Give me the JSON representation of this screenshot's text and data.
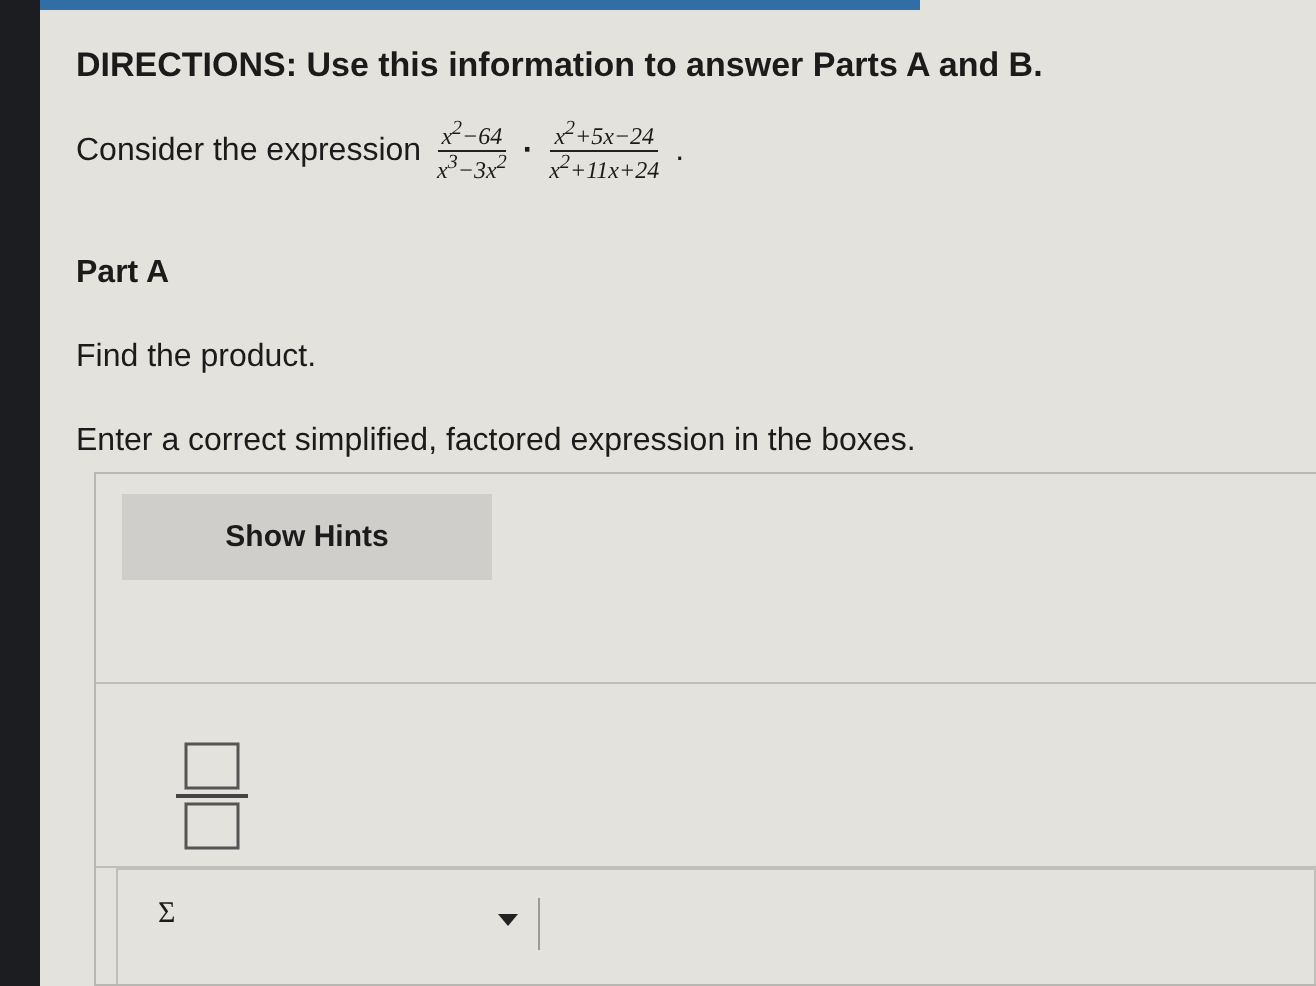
{
  "directions": "DIRECTIONS: Use this information to answer Parts A and B.",
  "prompt": {
    "lead": "Consider the expression",
    "fractions": [
      {
        "numerator": "x$^{2}$−64",
        "denominator": "x$^{3}$−3x$^{2}$"
      },
      {
        "numerator": "x$^{2}$+5x−24",
        "denominator": "x$^{2}$+11x+24"
      }
    ],
    "operator": "·",
    "end": "."
  },
  "part": {
    "title": "Part A",
    "task": "Find the product.",
    "instruction": "Enter a correct simplified, factored expression in the boxes."
  },
  "hints_button": "Show Hints",
  "toolbar": {
    "symbol": "Σ"
  }
}
